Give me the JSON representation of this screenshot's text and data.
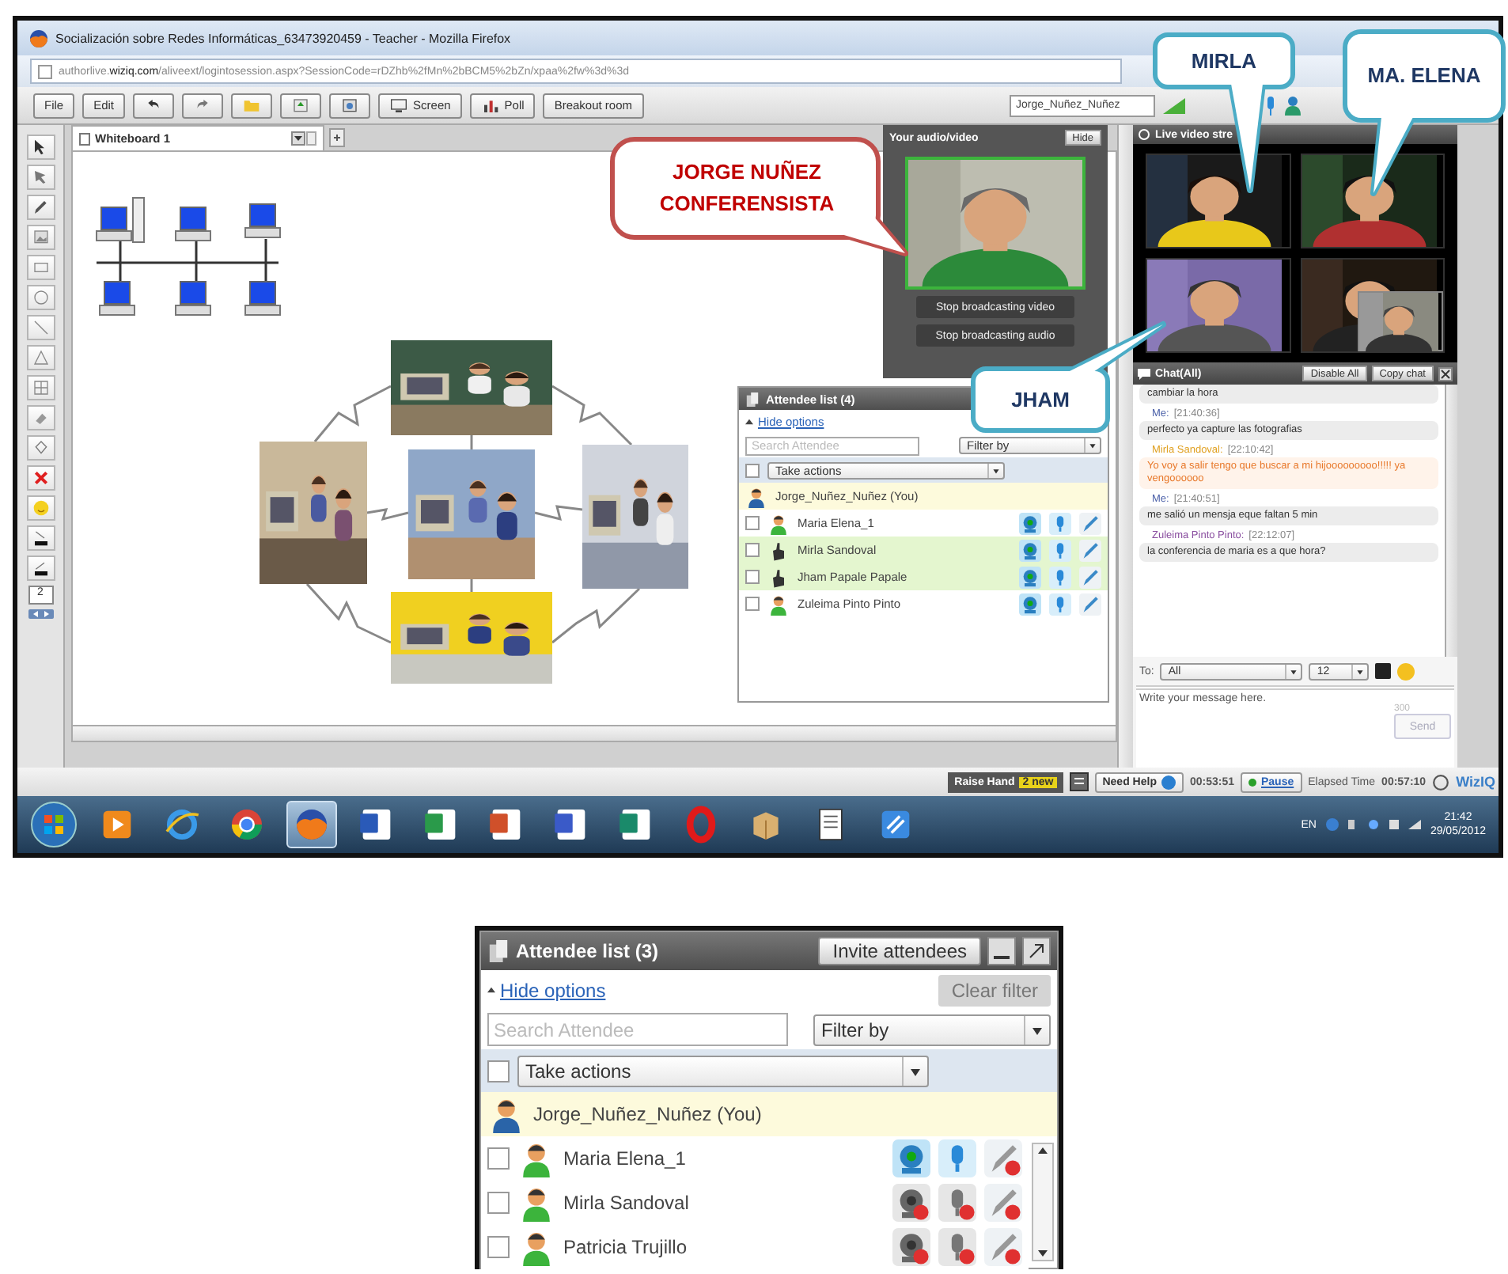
{
  "browser": {
    "title": "Socialización sobre Redes Informáticas_63473920459 - Teacher - Mozilla Firefox",
    "url": "authorlive.**wiziq.com**/aliveext/logintosession.aspx?SessionCode=rDZhb%2fMn%2bBCM5%2bZn/xpaa%2fw%3d%3d"
  },
  "toolbar": {
    "buttons": [
      {
        "kind": "text",
        "label": "File"
      },
      {
        "kind": "text",
        "label": "Edit"
      },
      {
        "kind": "undo"
      },
      {
        "kind": "redo"
      },
      {
        "kind": "folder"
      },
      {
        "kind": "upload"
      },
      {
        "kind": "capture"
      },
      {
        "kind": "screen",
        "label": "Screen"
      },
      {
        "kind": "poll",
        "label": "Poll"
      },
      {
        "kind": "text",
        "label": "Breakout room"
      }
    ],
    "user_name": "Jorge_Nuñez_Nuñez"
  },
  "whiteboard": {
    "tab": "Whiteboard 1",
    "page": "2"
  },
  "audio_video": {
    "title": "Your audio/video",
    "hide": "Hide",
    "buttons": [
      "Stop broadcasting video",
      "Stop broadcasting audio"
    ]
  },
  "live_video": {
    "title": "Live video stre"
  },
  "attendee_panels": [
    {
      "title": "Attendee list (4)",
      "hide_options": "Hide options",
      "search_placeholder": "Search Attendee",
      "filter": "Filter by",
      "actions": "Take actions",
      "actions_checked": false,
      "you": "Jorge_Nuñez_Nuñez (You)",
      "rows": [
        {
          "name": "Maria Elena_1",
          "checked": false,
          "hand_raised": false,
          "camera_on": true,
          "mic_on": true,
          "pen_on": true
        },
        {
          "name": "Mirla Sandoval",
          "checked": false,
          "hand_raised": true,
          "camera_on": true,
          "mic_on": true,
          "pen_on": true
        },
        {
          "name": "Jham Papale Papale",
          "checked": false,
          "hand_raised": true,
          "camera_on": true,
          "mic_on": true,
          "pen_on": true
        },
        {
          "name": "Zuleima Pinto Pinto",
          "checked": false,
          "hand_raised": false,
          "camera_on": true,
          "mic_on": true,
          "pen_on": true
        }
      ]
    },
    {
      "title": "Attendee list (3)",
      "invite": "Invite attendees",
      "clear_filter": "Clear filter",
      "hide_options": "Hide options",
      "search_placeholder": "Search Attendee",
      "filter": "Filter by",
      "actions": "Take actions",
      "actions_checked": false,
      "you": "Jorge_Nuñez_Nuñez (You)",
      "rows": [
        {
          "name": "Maria Elena_1",
          "checked": false,
          "hand_raised": false,
          "camera_on": true,
          "mic_on": true,
          "pen_on": false
        },
        {
          "name": "Mirla Sandoval",
          "checked": false,
          "hand_raised": false,
          "camera_on": false,
          "mic_on": false,
          "pen_on": false
        },
        {
          "name": "Patricia Trujillo",
          "checked": false,
          "hand_raised": false,
          "camera_on": false,
          "mic_on": false,
          "pen_on": false
        }
      ]
    }
  ],
  "chat": {
    "title": "Chat(All)",
    "disable": "Disable All",
    "copy": "Copy chat",
    "messages": [
      {
        "kind": "normal",
        "text": "cambiar la hora"
      },
      {
        "kind": "normal",
        "sender": "Me:",
        "color": "#4a5fa8",
        "time": "[21:40:36]",
        "text": "perfecto ya capture las fotografias"
      },
      {
        "kind": "alert",
        "sender": "Mirla Sandoval:",
        "color": "#e0a020",
        "time": "[22:10:42]",
        "text": "Yo voy a salir tengo que buscar a mi hijooooooooo!!!!! ya vengoooooo"
      },
      {
        "kind": "normal",
        "sender": "Me:",
        "color": "#4a5fa8",
        "time": "[21:40:51]",
        "text": "me salió un mensja eque faltan 5 min"
      },
      {
        "kind": "normal",
        "sender": "Zuleima Pinto Pinto:",
        "color": "#8a4fa0",
        "time": "[22:12:07]",
        "text": "la conferencia de maria es a que hora?"
      }
    ],
    "to_label": "To:",
    "to": "All",
    "font_size": "12",
    "placeholder": "Write your message here.",
    "counter": "300",
    "send": "Send"
  },
  "status_bar": {
    "raise_hand": "Raise Hand",
    "new_count": "2 new",
    "need_help": "Need Help",
    "timer": "00:53:51",
    "pause": "Pause",
    "elapsed_label": "Elapsed Time",
    "elapsed": "00:57:10",
    "brand": "WizIQ"
  },
  "taskbar": {
    "apps": [
      {
        "kind": "play",
        "active": false
      },
      {
        "kind": "ie",
        "active": false
      },
      {
        "kind": "chrome",
        "active": false
      },
      {
        "kind": "firefox",
        "active": true
      },
      {
        "kind": "word",
        "active": false
      },
      {
        "kind": "excel",
        "active": false
      },
      {
        "kind": "ppt",
        "active": false
      },
      {
        "kind": "visio",
        "active": false
      },
      {
        "kind": "publisher",
        "active": false
      },
      {
        "kind": "opera",
        "active": false
      },
      {
        "kind": "box",
        "active": false
      },
      {
        "kind": "notes",
        "active": false
      },
      {
        "kind": "tile",
        "active": false
      }
    ],
    "language": "EN",
    "time": "21:42",
    "date": "29/05/2012"
  },
  "callouts": [
    {
      "text": "JORGE NUÑEZ CONFERENSISTA",
      "kind": "speaker",
      "color": "#c0504d"
    },
    {
      "text": "MIRLA",
      "kind": "participant",
      "color": "#4bacc6"
    },
    {
      "text": "MA. ELENA",
      "kind": "participant",
      "color": "#4bacc6"
    },
    {
      "text": "JHAM",
      "kind": "participant",
      "color": "#4bacc6"
    }
  ]
}
